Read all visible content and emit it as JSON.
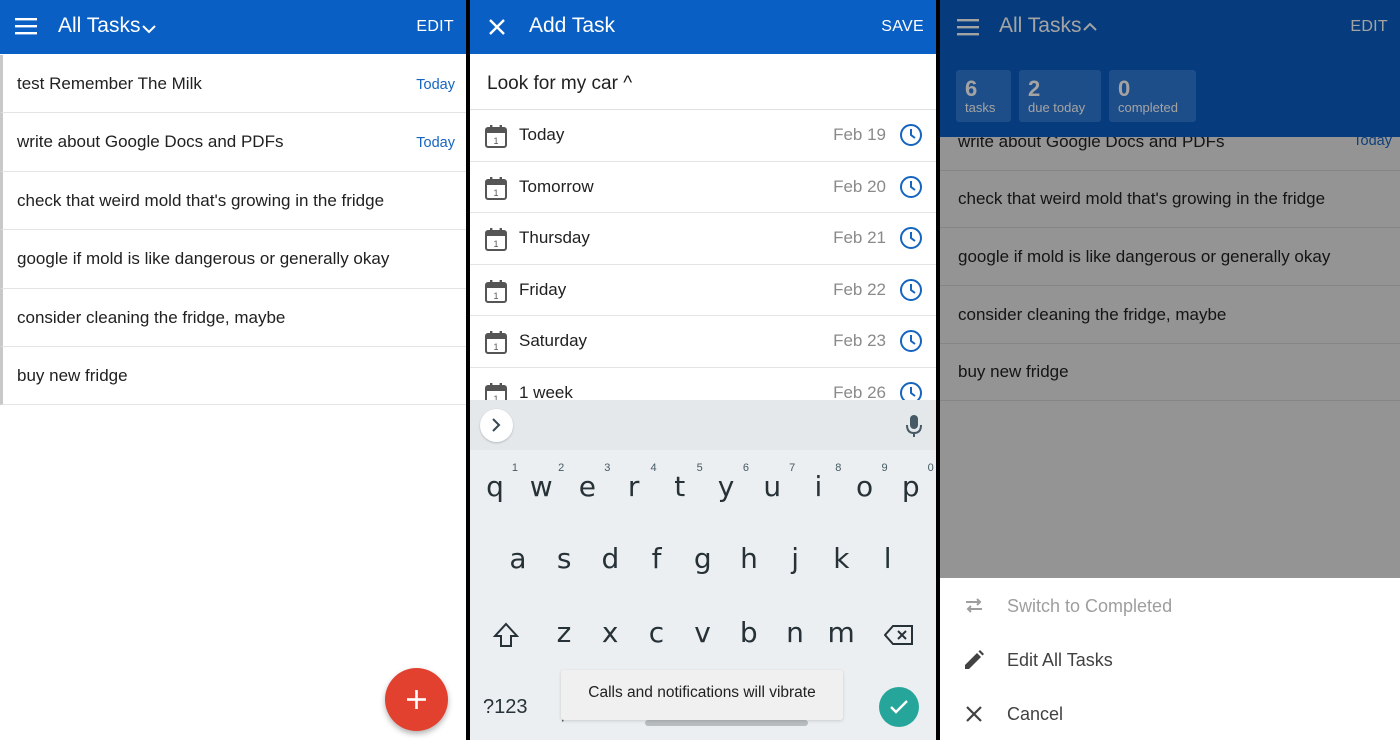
{
  "panel1": {
    "header": {
      "title": "All Tasks",
      "action": "EDIT"
    },
    "tasks": [
      {
        "title": "test Remember The Milk",
        "due": "Today"
      },
      {
        "title": "write about Google Docs and PDFs",
        "due": "Today"
      },
      {
        "title": "check that weird mold that's growing in the fridge",
        "due": ""
      },
      {
        "title": "google if mold is like dangerous or generally okay",
        "due": ""
      },
      {
        "title": "consider cleaning the fridge, maybe",
        "due": ""
      },
      {
        "title": "buy new fridge",
        "due": ""
      }
    ],
    "fab_icon": "plus-icon"
  },
  "panel2": {
    "header": {
      "title": "Add Task",
      "action": "SAVE"
    },
    "task_input": {
      "value": "Look for my car ^"
    },
    "due_options": [
      {
        "label": "Today",
        "date": "Feb 19"
      },
      {
        "label": "Tomorrow",
        "date": "Feb 20"
      },
      {
        "label": "Thursday",
        "date": "Feb 21"
      },
      {
        "label": "Friday",
        "date": "Feb 22"
      },
      {
        "label": "Saturday",
        "date": "Feb 23"
      },
      {
        "label": "1 week",
        "date": "Feb 26"
      }
    ],
    "keyboard": {
      "row1": [
        {
          "k": "q",
          "h": "1"
        },
        {
          "k": "w",
          "h": "2"
        },
        {
          "k": "e",
          "h": "3"
        },
        {
          "k": "r",
          "h": "4"
        },
        {
          "k": "t",
          "h": "5"
        },
        {
          "k": "y",
          "h": "6"
        },
        {
          "k": "u",
          "h": "7"
        },
        {
          "k": "i",
          "h": "8"
        },
        {
          "k": "o",
          "h": "9"
        },
        {
          "k": "p",
          "h": "0"
        }
      ],
      "row2": [
        "a",
        "s",
        "d",
        "f",
        "g",
        "h",
        "j",
        "k",
        "l"
      ],
      "row3": [
        "z",
        "x",
        "c",
        "v",
        "b",
        "n",
        "m"
      ],
      "symbols_key": "?123",
      "comma": ",",
      "period": "."
    },
    "toast": "Calls and notifications will vibrate"
  },
  "panel3": {
    "header": {
      "title": "All Tasks",
      "action": "EDIT"
    },
    "stats": [
      {
        "value": "6",
        "label": "tasks"
      },
      {
        "value": "2",
        "label": "due today"
      },
      {
        "value": "0",
        "label": "completed"
      }
    ],
    "tasks": [
      {
        "title": "write about Google Docs and PDFs",
        "due": "Today"
      },
      {
        "title": "check that weird mold that's growing in the fridge",
        "due": ""
      },
      {
        "title": "google if mold is like dangerous or generally okay",
        "due": ""
      },
      {
        "title": "consider cleaning the fridge, maybe",
        "due": ""
      },
      {
        "title": "buy new fridge",
        "due": ""
      }
    ],
    "menu": [
      {
        "label": "Switch to Completed",
        "icon": "swap-arrows-icon",
        "enabled": false
      },
      {
        "label": "Edit All Tasks",
        "icon": "pencil-icon",
        "enabled": true
      },
      {
        "label": "Cancel",
        "icon": "close-icon",
        "enabled": true
      }
    ]
  },
  "colors": {
    "brand": "#0a5fc4",
    "fab": "#e2412f",
    "link": "#1565c0",
    "enter_key": "#26a69a"
  }
}
